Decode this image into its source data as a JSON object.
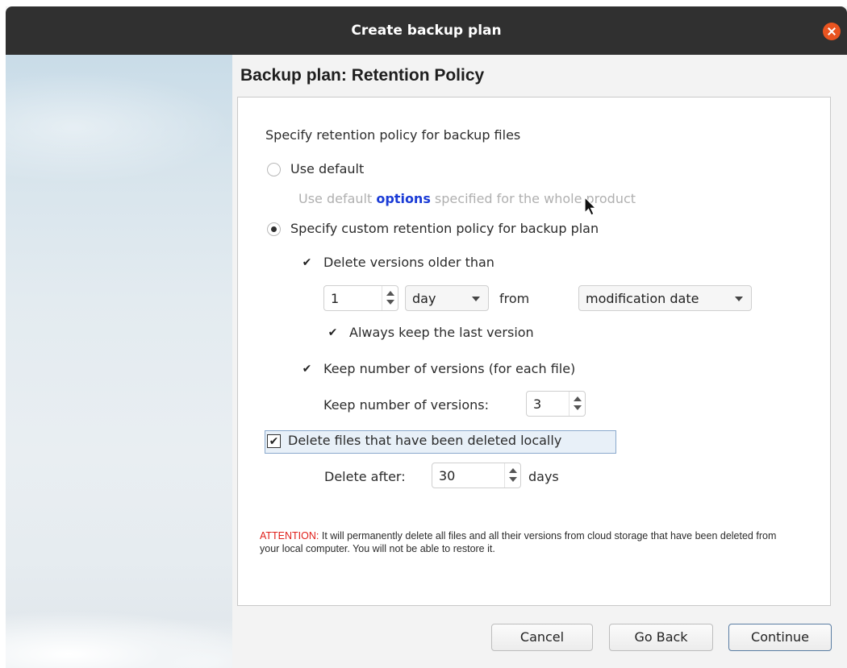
{
  "window": {
    "title": "Create backup plan"
  },
  "page": {
    "heading": "Backup plan: Retention Policy"
  },
  "retention": {
    "intro": "Specify retention policy for backup files",
    "use_default": {
      "label": "Use default",
      "checked": false,
      "hint_before": "Use default ",
      "hint_link": "options",
      "hint_after": " specified for the whole product"
    },
    "custom": {
      "label": "Specify custom retention policy for backup plan",
      "checked": true,
      "delete_older": {
        "label": "Delete versions older than",
        "checked": true,
        "amount": "1",
        "unit": "day",
        "from_label": "from",
        "basis": "modification date",
        "keep_last": {
          "label": "Always keep the last version",
          "checked": true
        }
      },
      "keep_number": {
        "label": "Keep number of versions (for each file)",
        "checked": true,
        "count_label": "Keep number of versions:",
        "count": "3"
      }
    },
    "delete_local": {
      "label": "Delete files that have been deleted locally",
      "checked": true,
      "after_label": "Delete after:",
      "after_value": "30",
      "after_unit": "days"
    },
    "attention": {
      "prefix": "ATTENTION:",
      "text": " It will permanently delete all files and all their versions from cloud storage that have been deleted from your local computer. You will not be able to restore it."
    }
  },
  "buttons": {
    "cancel": "Cancel",
    "back": "Go Back",
    "continue": "Continue"
  },
  "colors": {
    "titlebar": "#303030",
    "close": "#e95420",
    "link": "#1a3bd6",
    "warning": "#e0201b"
  }
}
